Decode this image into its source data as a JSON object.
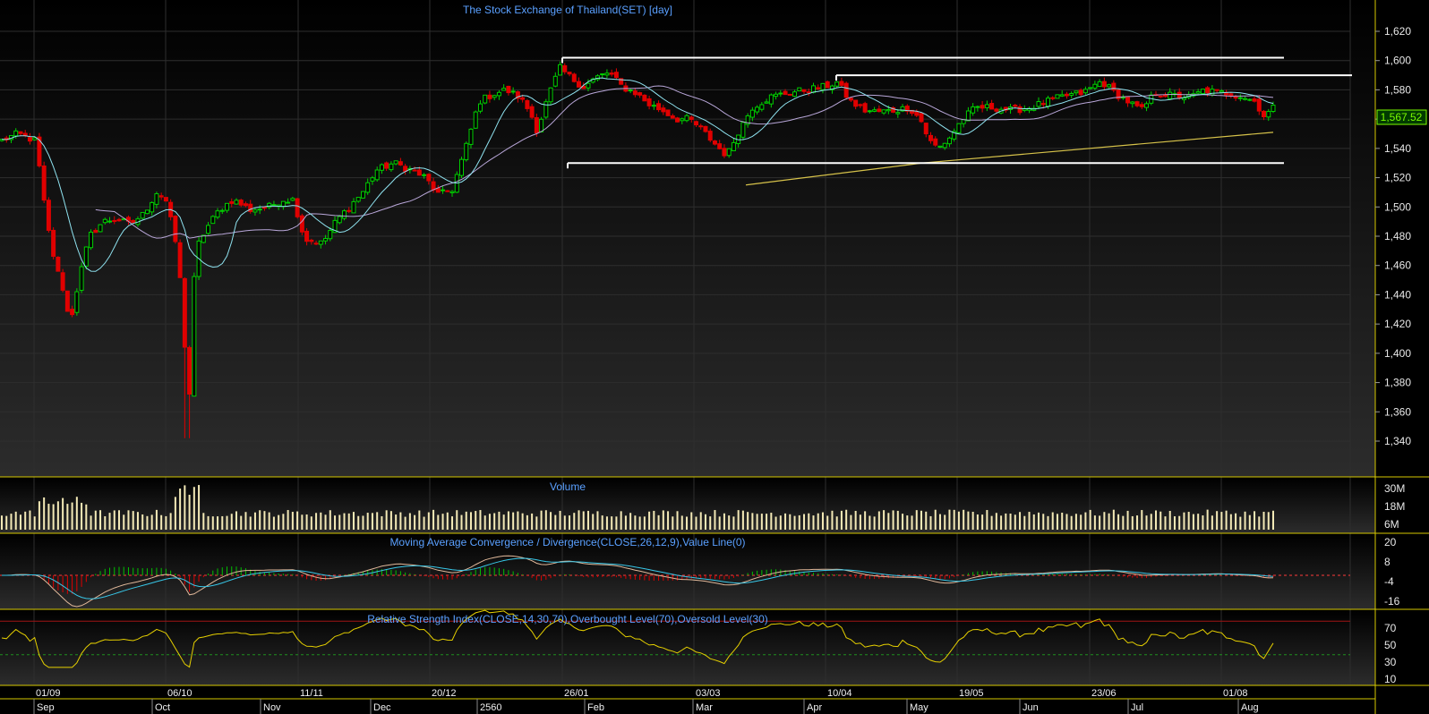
{
  "chart_data": {
    "type": "candlestick",
    "title": "The Stock Exchange of Thailand(SET) [day]",
    "price_axis": {
      "ylim": [
        1330,
        1630
      ],
      "ticks": [
        "1,620",
        "1,600",
        "1,580",
        "1,560",
        "1,540",
        "1,520",
        "1,500",
        "1,480",
        "1,460",
        "1,440",
        "1,420",
        "1,400",
        "1,380",
        "1,360",
        "1,340"
      ]
    },
    "last_price": "1,567.52",
    "candles": {
      "count": 272,
      "anchors": [
        {
          "x": 0,
          "y": 1545
        },
        {
          "x": 20,
          "y": 1550
        },
        {
          "x": 40,
          "y": 1545
        },
        {
          "x": 52,
          "y": 1490
        },
        {
          "x": 62,
          "y": 1460
        },
        {
          "x": 70,
          "y": 1445
        },
        {
          "x": 78,
          "y": 1420
        },
        {
          "x": 88,
          "y": 1450
        },
        {
          "x": 100,
          "y": 1480
        },
        {
          "x": 115,
          "y": 1490
        },
        {
          "x": 130,
          "y": 1492
        },
        {
          "x": 145,
          "y": 1488
        },
        {
          "x": 160,
          "y": 1495
        },
        {
          "x": 175,
          "y": 1510
        },
        {
          "x": 185,
          "y": 1505
        },
        {
          "x": 195,
          "y": 1480
        },
        {
          "x": 200,
          "y": 1460
        },
        {
          "x": 207,
          "y": 1400
        },
        {
          "x": 212,
          "y": 1370
        },
        {
          "x": 218,
          "y": 1470
        },
        {
          "x": 230,
          "y": 1485
        },
        {
          "x": 245,
          "y": 1498
        },
        {
          "x": 260,
          "y": 1505
        },
        {
          "x": 280,
          "y": 1498
        },
        {
          "x": 300,
          "y": 1500
        },
        {
          "x": 315,
          "y": 1505
        },
        {
          "x": 328,
          "y": 1505
        },
        {
          "x": 340,
          "y": 1478
        },
        {
          "x": 360,
          "y": 1475
        },
        {
          "x": 375,
          "y": 1490
        },
        {
          "x": 390,
          "y": 1500
        },
        {
          "x": 405,
          "y": 1510
        },
        {
          "x": 420,
          "y": 1525
        },
        {
          "x": 440,
          "y": 1530
        },
        {
          "x": 460,
          "y": 1525
        },
        {
          "x": 475,
          "y": 1520
        },
        {
          "x": 490,
          "y": 1508
        },
        {
          "x": 505,
          "y": 1512
        },
        {
          "x": 520,
          "y": 1540
        },
        {
          "x": 535,
          "y": 1572
        },
        {
          "x": 550,
          "y": 1577
        },
        {
          "x": 565,
          "y": 1580
        },
        {
          "x": 580,
          "y": 1575
        },
        {
          "x": 592,
          "y": 1565
        },
        {
          "x": 600,
          "y": 1552
        },
        {
          "x": 612,
          "y": 1575
        },
        {
          "x": 625,
          "y": 1595
        },
        {
          "x": 638,
          "y": 1588
        },
        {
          "x": 652,
          "y": 1582
        },
        {
          "x": 665,
          "y": 1588
        },
        {
          "x": 680,
          "y": 1592
        },
        {
          "x": 695,
          "y": 1582
        },
        {
          "x": 710,
          "y": 1578
        },
        {
          "x": 725,
          "y": 1570
        },
        {
          "x": 740,
          "y": 1566
        },
        {
          "x": 755,
          "y": 1560
        },
        {
          "x": 770,
          "y": 1560
        },
        {
          "x": 785,
          "y": 1552
        },
        {
          "x": 800,
          "y": 1542
        },
        {
          "x": 812,
          "y": 1535
        },
        {
          "x": 825,
          "y": 1552
        },
        {
          "x": 840,
          "y": 1568
        },
        {
          "x": 860,
          "y": 1575
        },
        {
          "x": 880,
          "y": 1578
        },
        {
          "x": 900,
          "y": 1580
        },
        {
          "x": 920,
          "y": 1582
        },
        {
          "x": 935,
          "y": 1585
        },
        {
          "x": 950,
          "y": 1572
        },
        {
          "x": 965,
          "y": 1566
        },
        {
          "x": 980,
          "y": 1565
        },
        {
          "x": 1000,
          "y": 1566
        },
        {
          "x": 1015,
          "y": 1568
        },
        {
          "x": 1028,
          "y": 1560
        },
        {
          "x": 1038,
          "y": 1545
        },
        {
          "x": 1048,
          "y": 1540
        },
        {
          "x": 1060,
          "y": 1547
        },
        {
          "x": 1075,
          "y": 1560
        },
        {
          "x": 1090,
          "y": 1568
        },
        {
          "x": 1110,
          "y": 1568
        },
        {
          "x": 1130,
          "y": 1566
        },
        {
          "x": 1150,
          "y": 1568
        },
        {
          "x": 1170,
          "y": 1572
        },
        {
          "x": 1190,
          "y": 1576
        },
        {
          "x": 1210,
          "y": 1578
        },
        {
          "x": 1230,
          "y": 1586
        },
        {
          "x": 1245,
          "y": 1578
        },
        {
          "x": 1260,
          "y": 1572
        },
        {
          "x": 1275,
          "y": 1566
        },
        {
          "x": 1290,
          "y": 1578
        },
        {
          "x": 1310,
          "y": 1576
        },
        {
          "x": 1330,
          "y": 1575
        },
        {
          "x": 1345,
          "y": 1580
        },
        {
          "x": 1360,
          "y": 1578
        },
        {
          "x": 1375,
          "y": 1578
        },
        {
          "x": 1390,
          "y": 1575
        },
        {
          "x": 1402,
          "y": 1572
        },
        {
          "x": 1412,
          "y": 1562
        },
        {
          "x": 1422,
          "y": 1567.52
        }
      ],
      "pixel_range": [
        0,
        1422
      ]
    },
    "overlays": {
      "sma_fast": "cyan",
      "sma_slow": "lavender",
      "long_trend": "yellow"
    },
    "resistance_lines": [
      {
        "from": 628,
        "to": 1434,
        "y": 1602
      },
      {
        "from": 934,
        "to": 1510,
        "y": 1590
      },
      {
        "from": 634,
        "to": 1434,
        "y": 1530
      }
    ],
    "volume": {
      "title": "Volume",
      "ticks": [
        "30M",
        "18M",
        "6M"
      ]
    },
    "macd": {
      "title": "Moving Average Convergence / Divergence(CLOSE,26,12,9),Value Line(0)",
      "ticks": [
        "20",
        "8",
        "-4",
        "-16"
      ]
    },
    "rsi": {
      "title": "Relative Strength Index(CLOSE,14,30,70),Overbought Level(70),Oversold Level(30)",
      "ticks": [
        "70",
        "50",
        "30",
        "10"
      ],
      "overbought": 70,
      "oversold": 30
    },
    "date_axis": {
      "upper_labels": [
        "01/09",
        "06/10",
        "11/11",
        "20/12",
        "26/01",
        "03/03",
        "10/04",
        "19/05",
        "23/06",
        "01/08"
      ],
      "lower_labels": [
        "Sep",
        "Oct",
        "Nov",
        "Dec",
        "2560",
        "Feb",
        "Mar",
        "Apr",
        "May",
        "Jun",
        "Jul",
        "Aug"
      ]
    },
    "colors": {
      "up": "#00d000",
      "down": "#e00000",
      "title": "#5aa0ff",
      "grid": "#2a2a2a",
      "panel_border": "#d6c800",
      "last_label": "#7CFC00"
    }
  }
}
